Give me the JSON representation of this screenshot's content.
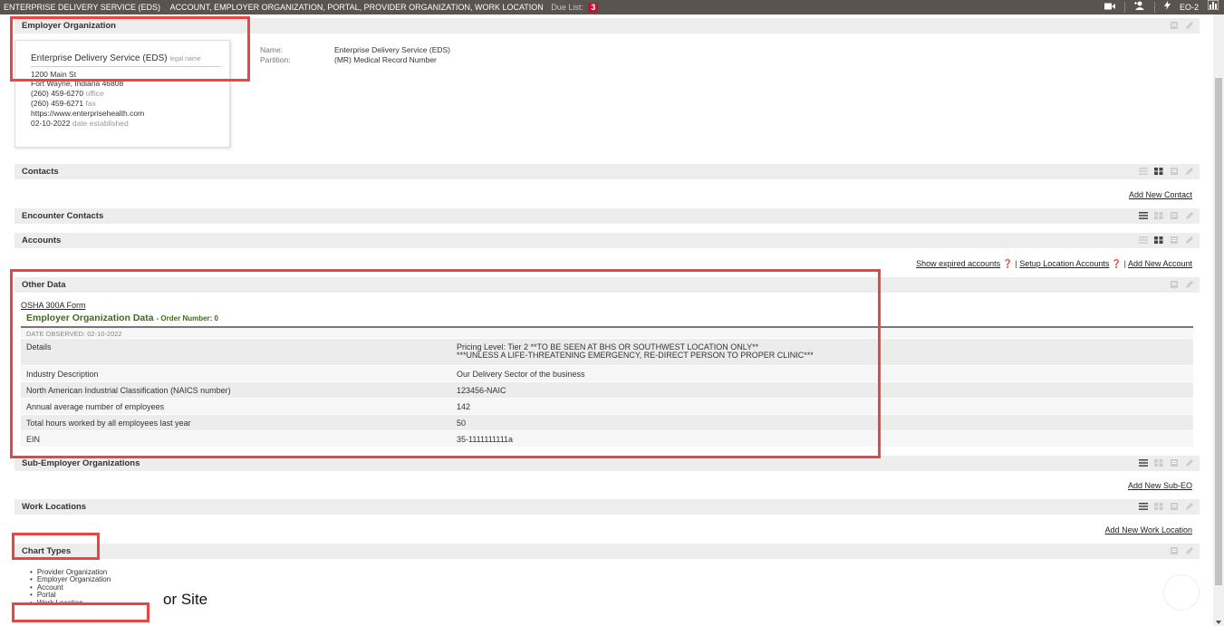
{
  "topbar": {
    "org": "Enterprise Delivery Service (EDS)",
    "breadcrumb": "Account, Employer Organization, Portal, Provider Organization, Work Location",
    "due_label": "Due List:",
    "due_count": "3",
    "user_code": "EO-2",
    "icons": [
      "video-icon",
      "user-add-icon",
      "lightning-icon",
      "chart-icon"
    ]
  },
  "employer": {
    "title": "Employer Organization",
    "card": {
      "legal_name": "Enterprise Delivery Service (EDS)",
      "legal_name_tag": "legal name",
      "address1": "1200 Main St",
      "address2": "Fort Wayne, Indiana 46808",
      "office_phone": "(260) 459-6270",
      "office_label": "office",
      "fax_phone": "(260) 459-6271",
      "fax_label": "fax",
      "website": "https://www.enterprisehealth.com",
      "established": "02-10-2022",
      "established_label": "date established"
    },
    "name_label": "Name:",
    "name_value": "Enterprise Delivery Service (EDS)",
    "partition_label": "Partition:",
    "partition_value": "(MR) Medical Record Number"
  },
  "contacts": {
    "title": "Contacts",
    "add_link": "Add New Contact"
  },
  "encounter_contacts": {
    "title": "Encounter Contacts"
  },
  "accounts": {
    "title": "Accounts",
    "show_expired": "Show expired accounts",
    "setup_location": "Setup Location Accounts",
    "add_account": "Add New Account",
    "separator": "|"
  },
  "other_data": {
    "title": "Other Data",
    "osha_link": "OSHA 300A Form",
    "eo_title": "Employer Organization Data",
    "order_label": "- Order Number: 0",
    "date_observed": "DATE OBSERVED: 02-10-2022",
    "rows": [
      {
        "label": "Details",
        "value": "Pricing Level: Tier 2 **TO BE SEEN AT BHS OR SOUTHWEST LOCATION ONLY**",
        "value2": "***UNLESS A LIFE-THREATENING EMERGENCY, RE-DIRECT PERSON TO PROPER CLINIC***"
      },
      {
        "label": "Industry Description",
        "value": "Our Delivery Sector of the business"
      },
      {
        "label": "North American Industrial Classification (NAICS number)",
        "value": "123456-NAIC"
      },
      {
        "label": "Annual average number of employees",
        "value": "142"
      },
      {
        "label": "Total hours worked by all employees last year",
        "value": "50"
      },
      {
        "label": "EIN",
        "value": "35-1111111111a"
      }
    ]
  },
  "sub_eo": {
    "title": "Sub-Employer Organizations",
    "add_link": "Add New Sub-EO"
  },
  "work_locations": {
    "title": "Work Locations",
    "add_link": "Add New Work Location"
  },
  "chart_types": {
    "title": "Chart Types",
    "items": [
      "Provider Organization",
      "Employer Organization",
      "Account",
      "Portal",
      "Work Location"
    ]
  },
  "annotation": "or Site",
  "colors": {
    "highlight": "#e84545",
    "topbar": "#595450",
    "section_bar": "#ededed",
    "eo_green": "#3d6b1a",
    "due_badge": "#c8102e"
  }
}
